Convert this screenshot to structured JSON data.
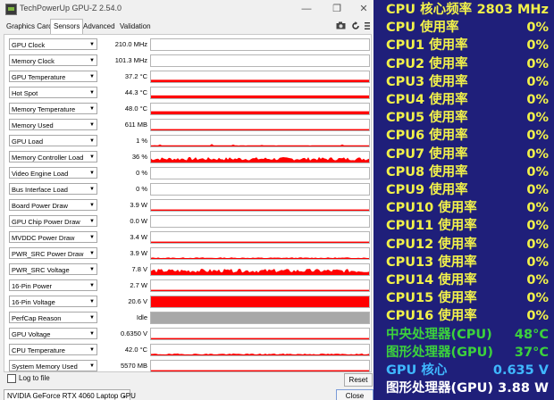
{
  "window": {
    "title": "TechPowerUp GPU-Z 2.54.0",
    "minimize": "—",
    "restore": "❐",
    "close": "✕"
  },
  "tabs": [
    {
      "label": "Graphics Card",
      "active": false
    },
    {
      "label": "Sensors",
      "active": true
    },
    {
      "label": "Advanced",
      "active": false
    },
    {
      "label": "Validation",
      "active": false
    }
  ],
  "toolbar_icons": [
    "camera-icon",
    "refresh-icon",
    "menu-icon"
  ],
  "sensors": [
    {
      "label": "GPU Clock",
      "value": "210.0 MHz",
      "fill": 0.0,
      "pattern": "empty"
    },
    {
      "label": "Memory Clock",
      "value": "101.3 MHz",
      "fill": 0.0,
      "pattern": "empty"
    },
    {
      "label": "GPU Temperature",
      "value": "37.2 °C",
      "fill": 0.22,
      "pattern": "line"
    },
    {
      "label": "Hot Spot",
      "value": "44.3 °C",
      "fill": 0.26,
      "pattern": "line"
    },
    {
      "label": "Memory Temperature",
      "value": "48.0 °C",
      "fill": 0.28,
      "pattern": "line"
    },
    {
      "label": "Memory Used",
      "value": "611 MB",
      "fill": 0.08,
      "pattern": "line"
    },
    {
      "label": "GPU Load",
      "value": "1 %",
      "fill": 0.04,
      "pattern": "sparse"
    },
    {
      "label": "Memory Controller Load",
      "value": "36 %",
      "fill": 0.35,
      "pattern": "noisy"
    },
    {
      "label": "Video Engine Load",
      "value": "0 %",
      "fill": 0.0,
      "pattern": "empty"
    },
    {
      "label": "Bus Interface Load",
      "value": "0 %",
      "fill": 0.0,
      "pattern": "empty"
    },
    {
      "label": "Board Power Draw",
      "value": "3.9 W",
      "fill": 0.04,
      "pattern": "line"
    },
    {
      "label": "GPU Chip Power Draw",
      "value": "0.0 W",
      "fill": 0.0,
      "pattern": "empty"
    },
    {
      "label": "MVDDC Power Draw",
      "value": "3.4 W",
      "fill": 0.04,
      "pattern": "line"
    },
    {
      "label": "PWR_SRC Power Draw",
      "value": "3.9 W",
      "fill": 0.1,
      "pattern": "noisy"
    },
    {
      "label": "PWR_SRC Voltage",
      "value": "7.8 V",
      "fill": 0.4,
      "pattern": "noisy"
    },
    {
      "label": "16-Pin Power",
      "value": "2.7 W",
      "fill": 0.04,
      "pattern": "line"
    },
    {
      "label": "16-Pin Voltage",
      "value": "20.6 V",
      "fill": 1.0,
      "pattern": "solid"
    },
    {
      "label": "PerfCap Reason",
      "value": "Idle",
      "fill": 1.0,
      "pattern": "gray"
    },
    {
      "label": "GPU Voltage",
      "value": "0.6350 V",
      "fill": 0.06,
      "pattern": "line"
    },
    {
      "label": "CPU Temperature",
      "value": "42.0 °C",
      "fill": 0.12,
      "pattern": "noisy"
    },
    {
      "label": "System Memory Used",
      "value": "5570 MB",
      "fill": 0.1,
      "pattern": "line"
    }
  ],
  "footer": {
    "log_label": "Log to file",
    "reset_label": "Reset",
    "gpu_name": "NVIDIA GeForce RTX 4060 Laptop GPU",
    "close_label": "Close"
  },
  "osd": [
    {
      "label": "CPU 核心频率",
      "value": "2803 MHz",
      "color": "#f2f24a"
    },
    {
      "label": "CPU 使用率",
      "value": "0%",
      "color": "#f2f24a"
    },
    {
      "label": "CPU1 使用率",
      "value": "0%",
      "color": "#f2f24a"
    },
    {
      "label": "CPU2 使用率",
      "value": "0%",
      "color": "#f2f24a"
    },
    {
      "label": "CPU3 使用率",
      "value": "0%",
      "color": "#f2f24a"
    },
    {
      "label": "CPU4 使用率",
      "value": "0%",
      "color": "#f2f24a"
    },
    {
      "label": "CPU5 使用率",
      "value": "0%",
      "color": "#f2f24a"
    },
    {
      "label": "CPU6 使用率",
      "value": "0%",
      "color": "#f2f24a"
    },
    {
      "label": "CPU7 使用率",
      "value": "0%",
      "color": "#f2f24a"
    },
    {
      "label": "CPU8 使用率",
      "value": "0%",
      "color": "#f2f24a"
    },
    {
      "label": "CPU9 使用率",
      "value": "0%",
      "color": "#f2f24a"
    },
    {
      "label": "CPU10 使用率",
      "value": "0%",
      "color": "#f2f24a"
    },
    {
      "label": "CPU11 使用率",
      "value": "0%",
      "color": "#f2f24a"
    },
    {
      "label": "CPU12 使用率",
      "value": "0%",
      "color": "#f2f24a"
    },
    {
      "label": "CPU13 使用率",
      "value": "0%",
      "color": "#f2f24a"
    },
    {
      "label": "CPU14 使用率",
      "value": "0%",
      "color": "#f2f24a"
    },
    {
      "label": "CPU15 使用率",
      "value": "0%",
      "color": "#f2f24a"
    },
    {
      "label": "CPU16 使用率",
      "value": "0%",
      "color": "#f2f24a"
    },
    {
      "label": "中央处理器(CPU)",
      "value": "48°C",
      "color": "#3cd23c"
    },
    {
      "label": "图形处理器(GPU)",
      "value": "37°C",
      "color": "#3cd23c"
    },
    {
      "label": "GPU 核心",
      "value": "0.635 V",
      "color": "#3fb8ff"
    },
    {
      "label": "图形处理器(GPU)",
      "value": "3.88 W",
      "color": "#ffffff"
    }
  ],
  "colors": {
    "graph_red": "#ff0000",
    "graph_gray": "#a8a8a8",
    "osd_background": "#1f1f7a"
  }
}
